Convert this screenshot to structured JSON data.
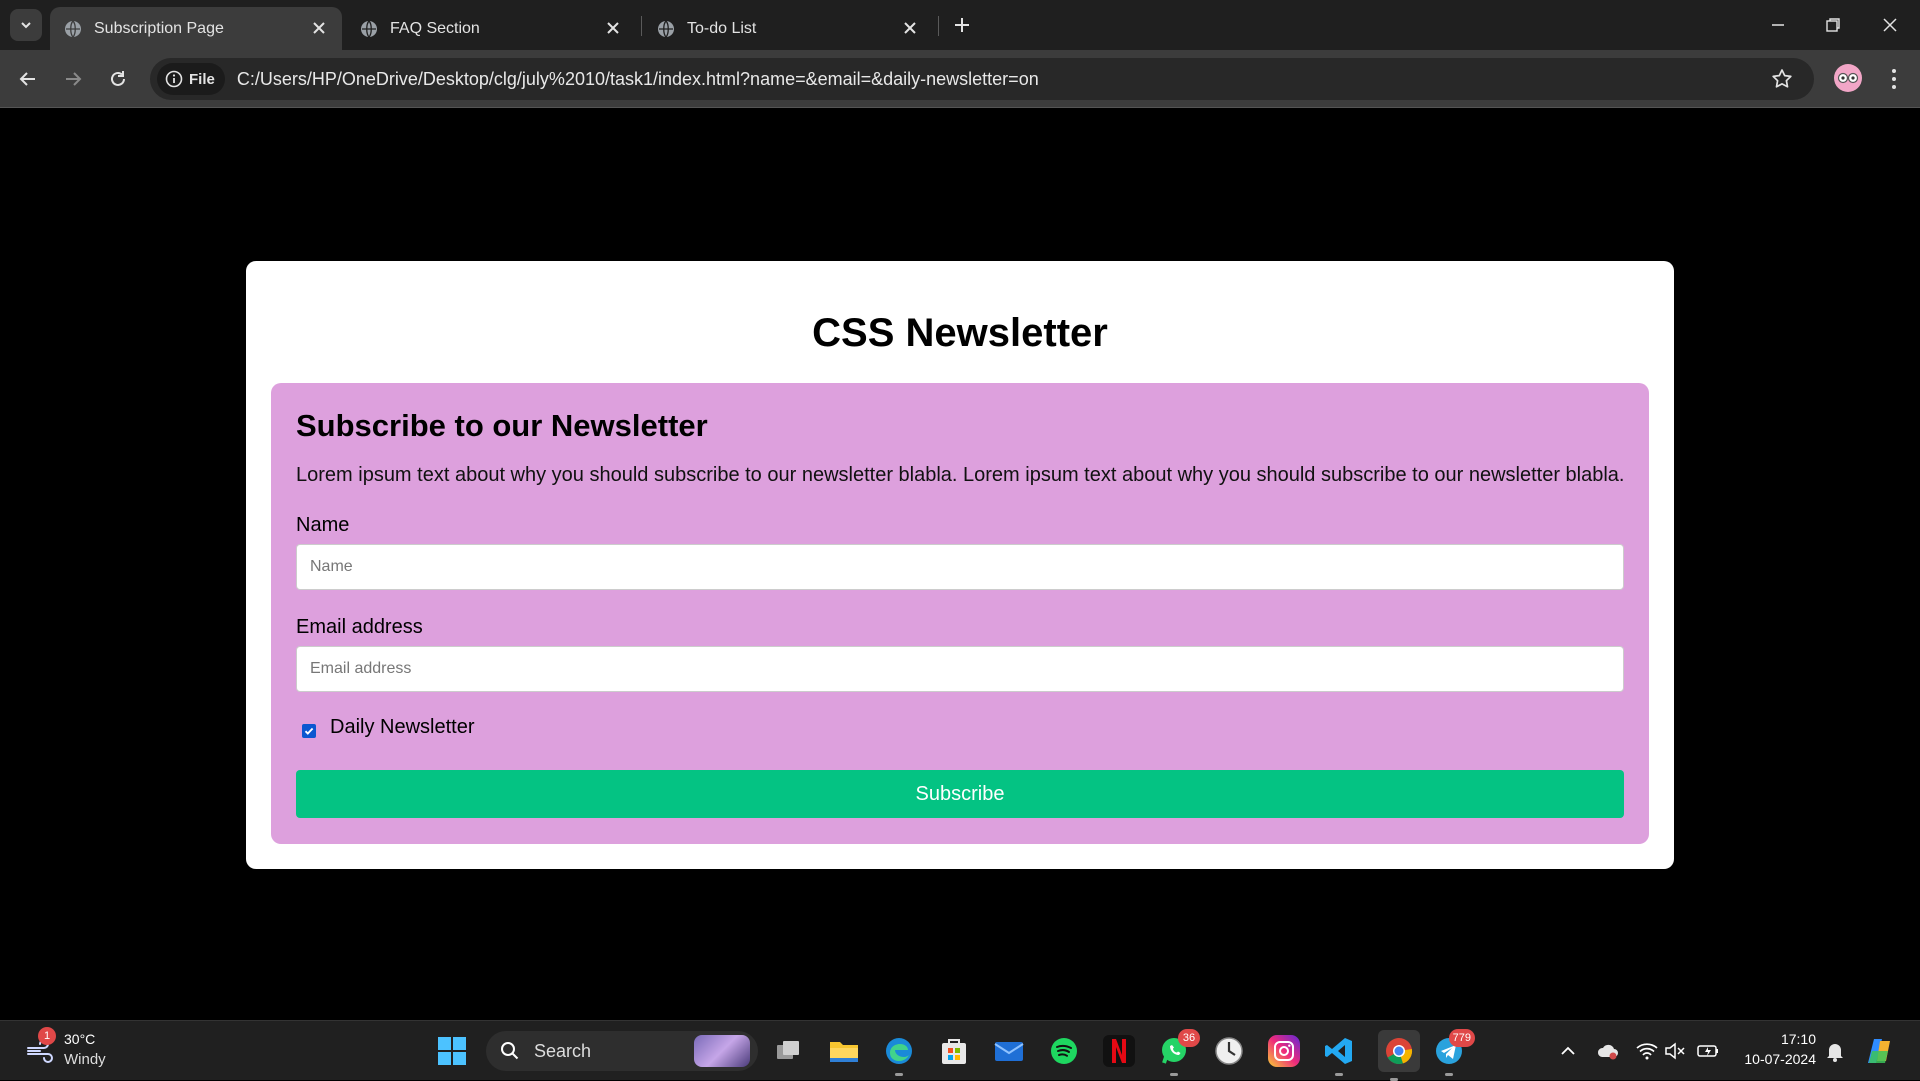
{
  "browser": {
    "tabs": [
      {
        "title": "Subscription Page",
        "active": true
      },
      {
        "title": "FAQ Section",
        "active": false
      },
      {
        "title": "To-do List",
        "active": false
      }
    ],
    "site_chip": "File",
    "url": "C:/Users/HP/OneDrive/Desktop/clg/july%2010/task1/index.html?name=&email=&daily-newsletter=on"
  },
  "page": {
    "title": "CSS Newsletter",
    "form": {
      "heading": "Subscribe to our Newsletter",
      "description": "Lorem ipsum text about why you should subscribe to our newsletter blabla. Lorem ipsum text about why you should subscribe to our newsletter blabla.",
      "name_label": "Name",
      "name_placeholder": "Name",
      "name_value": "",
      "email_label": "Email address",
      "email_placeholder": "Email address",
      "email_value": "",
      "checkbox_label": "Daily Newsletter",
      "checkbox_checked": true,
      "submit_label": "Subscribe"
    }
  },
  "colors": {
    "panel_bg": "#dda0dd",
    "button_bg": "#04c383",
    "checkbox": "#0b57d0"
  },
  "taskbar": {
    "weather": {
      "temp": "30°C",
      "condition": "Windy",
      "alert_count": "1"
    },
    "search_label": "Search",
    "apps": [
      {
        "name": "task-view-icon"
      },
      {
        "name": "file-explorer-icon"
      },
      {
        "name": "edge-icon"
      },
      {
        "name": "microsoft-store-icon"
      },
      {
        "name": "mail-icon"
      },
      {
        "name": "spotify-icon"
      },
      {
        "name": "netflix-icon"
      },
      {
        "name": "whatsapp-icon",
        "badge": "36"
      },
      {
        "name": "clock-app-icon"
      },
      {
        "name": "instagram-icon"
      },
      {
        "name": "vscode-icon"
      },
      {
        "name": "chrome-icon"
      },
      {
        "name": "telegram-icon",
        "badge": "779"
      }
    ],
    "time": "17:10",
    "date": "10-07-2024"
  }
}
